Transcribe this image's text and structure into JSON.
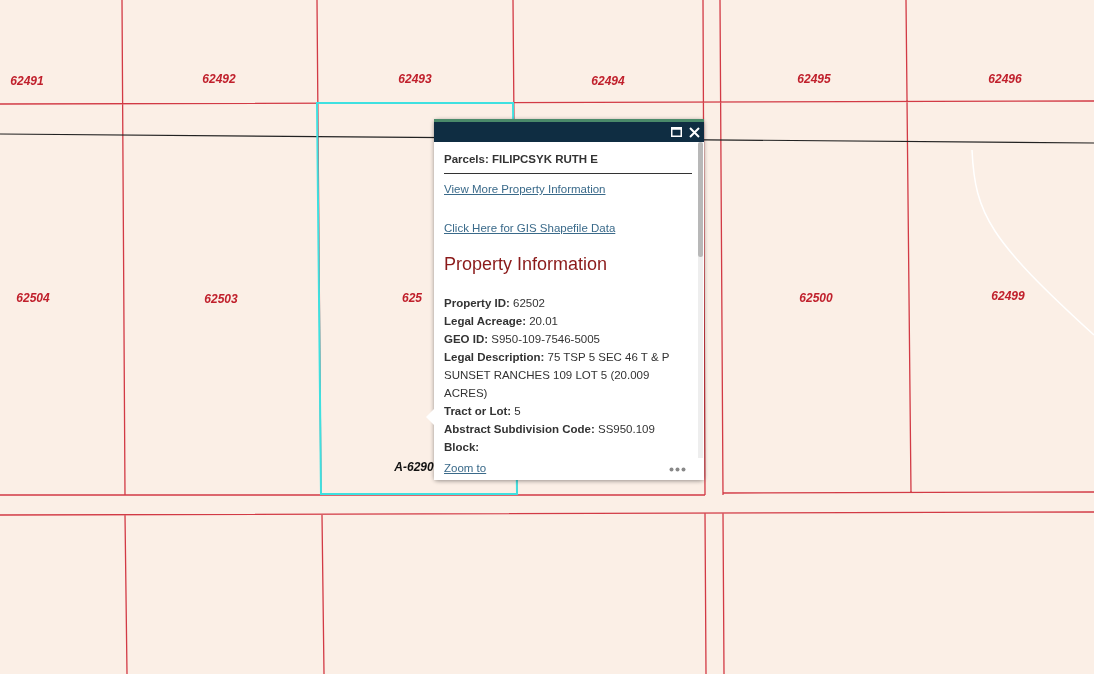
{
  "map": {
    "parcel_labels": [
      {
        "text": "62491",
        "kind": "parcel"
      },
      {
        "text": "62492",
        "kind": "parcel"
      },
      {
        "text": "62493",
        "kind": "parcel"
      },
      {
        "text": "62494",
        "kind": "parcel"
      },
      {
        "text": "62495",
        "kind": "parcel"
      },
      {
        "text": "62496",
        "kind": "parcel"
      },
      {
        "text": "62504",
        "kind": "parcel"
      },
      {
        "text": "62503",
        "kind": "parcel"
      },
      {
        "text": "625",
        "kind": "parcel"
      },
      {
        "text": "62500",
        "kind": "parcel"
      },
      {
        "text": "62499",
        "kind": "parcel"
      },
      {
        "text": "A-6290",
        "kind": "abstract"
      }
    ]
  },
  "popup": {
    "title": "Parcels: FILIPCSYK RUTH E",
    "links": [
      "View More Property Information",
      "Click Here for GIS Shapefile Data"
    ],
    "heading": "Property Information",
    "fields": [
      {
        "label": "Property ID:",
        "value": "62502"
      },
      {
        "label": "Legal Acreage:",
        "value": "20.01"
      },
      {
        "label": "GEO ID:",
        "value": "S950-109-7546-5005"
      },
      {
        "label": "Legal Description:",
        "value": "75 TSP 5 SEC 46 T & P SUNSET RANCHES 109 LOT 5 (20.009 ACRES)"
      },
      {
        "label": "Tract or Lot:",
        "value": "5"
      },
      {
        "label": "Abstract Subdivision Code:",
        "value": "SS950.109"
      },
      {
        "label": "Block:"
      }
    ],
    "footer_link": "Zoom to"
  }
}
